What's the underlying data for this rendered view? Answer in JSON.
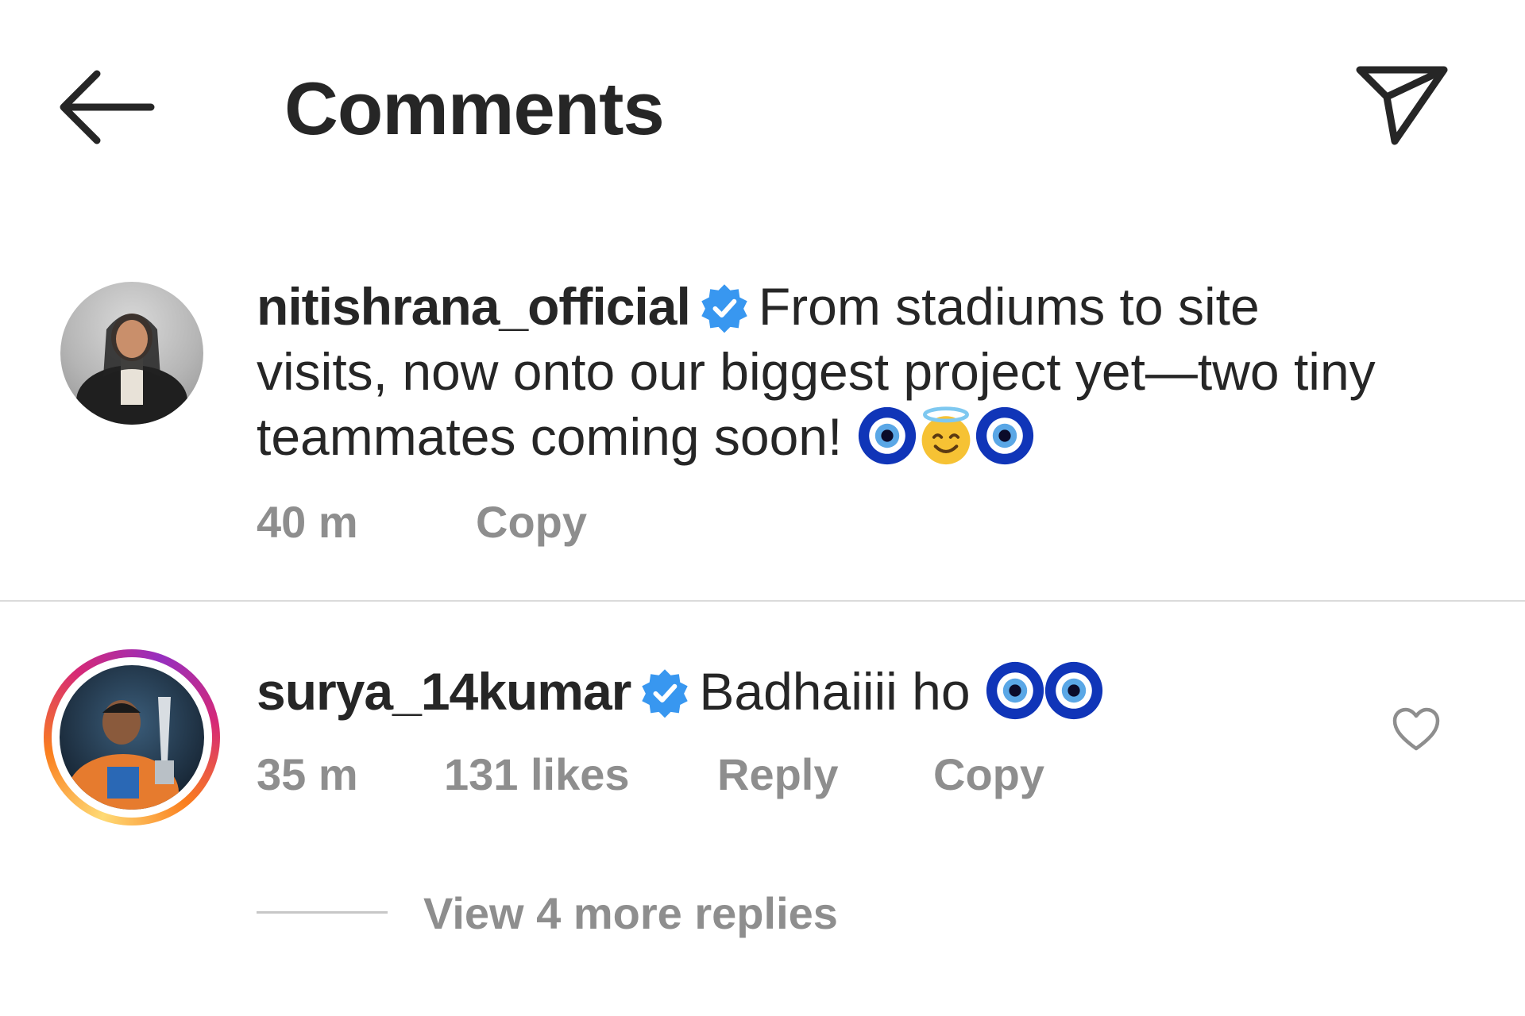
{
  "header": {
    "title": "Comments",
    "back_icon": "arrow-left-icon",
    "share_icon": "paper-plane-icon"
  },
  "caption": {
    "username": "nitishrana_official",
    "verified": true,
    "text": "From stadiums to site visits, now onto our biggest project yet—two tiny teammates coming soon!",
    "emojis": [
      "nazar-amulet",
      "smiling-face-with-halo",
      "nazar-amulet"
    ],
    "time": "40 m",
    "copy_label": "Copy"
  },
  "comments": [
    {
      "username": "surya_14kumar",
      "verified": true,
      "text": "Badhaiiii ho",
      "emojis": [
        "nazar-amulet",
        "nazar-amulet"
      ],
      "time": "35 m",
      "likes": "131 likes",
      "reply_label": "Reply",
      "copy_label": "Copy",
      "like_icon": "heart-outline-icon",
      "view_replies_label": "View 4 more replies"
    }
  ],
  "colors": {
    "text_primary": "#262626",
    "text_secondary": "#8e8e8e",
    "verified_blue": "#3897f0",
    "divider": "#dbdbdb"
  }
}
